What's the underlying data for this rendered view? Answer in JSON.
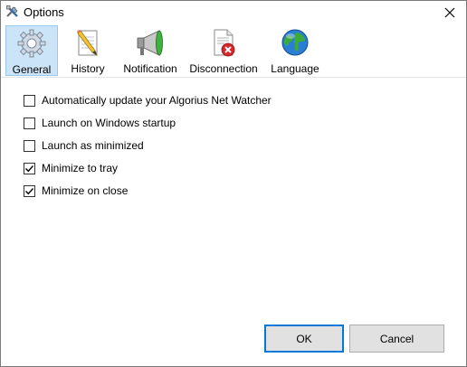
{
  "window": {
    "title": "Options"
  },
  "tabs": [
    {
      "label": "General",
      "icon": "gear-icon",
      "active": true
    },
    {
      "label": "History",
      "icon": "pencil-notepad-icon",
      "active": false
    },
    {
      "label": "Notification",
      "icon": "megaphone-icon",
      "active": false
    },
    {
      "label": "Disconnection",
      "icon": "document-error-icon",
      "active": false
    },
    {
      "label": "Language",
      "icon": "globe-icon",
      "active": false
    }
  ],
  "options": [
    {
      "label": "Automatically update your Algorius Net Watcher",
      "checked": false
    },
    {
      "label": "Launch on Windows startup",
      "checked": false
    },
    {
      "label": "Launch as minimized",
      "checked": false
    },
    {
      "label": "Minimize to tray",
      "checked": true
    },
    {
      "label": "Minimize on close",
      "checked": true
    }
  ],
  "buttons": {
    "ok": "OK",
    "cancel": "Cancel"
  },
  "colors": {
    "active_tab_bg": "#cce4f7",
    "active_tab_border": "#99c9ef",
    "default_button_border": "#0078d7"
  }
}
